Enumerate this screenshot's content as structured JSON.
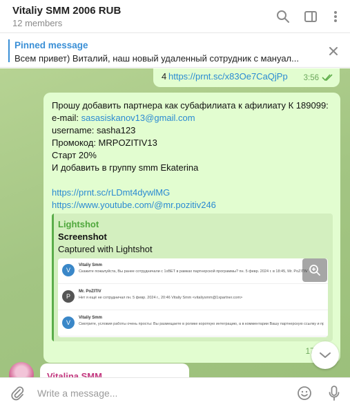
{
  "header": {
    "title": "Vitaliy SMM 2006 RUB",
    "subtitle": "12 members",
    "icons": [
      "search-icon",
      "sidebar-toggle-icon",
      "more-icon"
    ]
  },
  "pinned": {
    "title": "Pinned message",
    "text": "Всем привет)  Виталий,  наш новый удаленный сотрудник с мануал...",
    "close_icon": "close-icon"
  },
  "messages": {
    "top_out": {
      "prefix": "4",
      "link": "https://prnt.sc/x83Oe7CaQjPp",
      "time": "3:56"
    },
    "main_out": {
      "lines": [
        "Прошу добавить партнера как субафилиата к афилиату К 189099:",
        "e-mail:",
        "username: sasha123",
        "Промокод: MRPOZITIV13",
        "Старт 20%",
        "И добавить в группу smm Ekaterina"
      ],
      "email": "sasasiskanov13@gmail.com",
      "link1": "https://prnt.sc/rLDmt4dywlMG",
      "link2": "https://www.youtube.com/@mr.pozitiv246",
      "time": "17:1",
      "preview": {
        "site": "Lightshot",
        "title": "Screenshot",
        "description": "Captured with Lightshot",
        "rows": [
          {
            "avatar": "V",
            "name": "Vitaliy Smm",
            "text": "Скажите пожалуйста, Вы ранее сотрудничали с 1xBET в рамках партнерской программы? пн. 5 февр. 2024 г. в 18:45, Mr. PoZITIV"
          },
          {
            "avatar": "P",
            "name": "Mr. PoZITIV",
            "text": "Нет я ещё не сотрудничал пн. 5 февр. 2024 г., 20:46 Vitaliy Smm <vitaliysmm@1xpartner.com>"
          },
          {
            "avatar": "V",
            "name": "Vitaliy Smm",
            "text": "Смотрите, условия работы очень просты: Вы размещаете в ролике короткую интеграцию, а в комментарии Вашу партнерскую ссылку и пр"
          }
        ]
      }
    },
    "incoming": {
      "author": "Vitalina SMM"
    }
  },
  "composer": {
    "placeholder": "Write a message..."
  },
  "colors": {
    "accent": "#3a8fd6",
    "outgoing_bubble": "#e2fdd0",
    "link": "#2a8ad2",
    "author_incoming": "#c2367e"
  }
}
